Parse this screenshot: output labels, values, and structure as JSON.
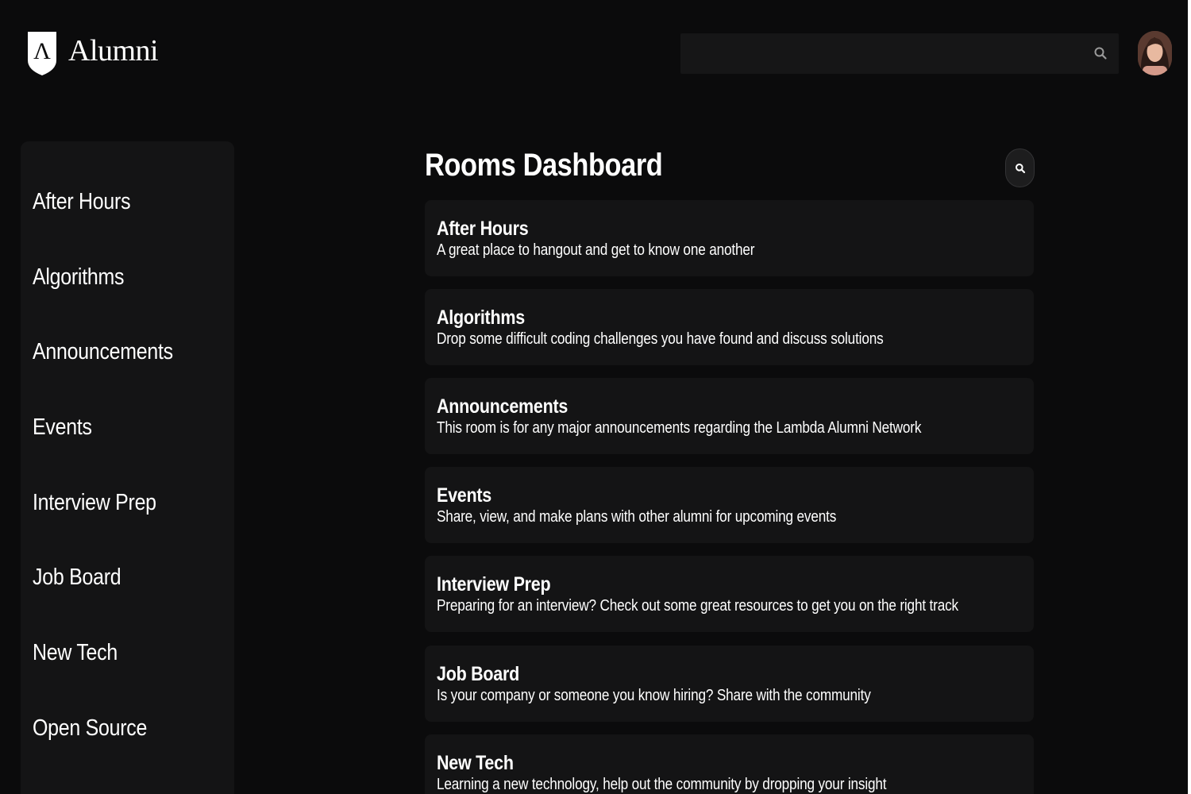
{
  "header": {
    "logo_text": "Alumni",
    "logo_letter": "Λ",
    "search": {
      "value": "",
      "placeholder": ""
    }
  },
  "sidebar": {
    "items": [
      {
        "label": "After Hours"
      },
      {
        "label": "Algorithms"
      },
      {
        "label": "Announcements"
      },
      {
        "label": "Events"
      },
      {
        "label": "Interview Prep"
      },
      {
        "label": "Job Board"
      },
      {
        "label": "New Tech"
      },
      {
        "label": "Open Source"
      }
    ]
  },
  "main": {
    "title": "Rooms Dashboard",
    "rooms": [
      {
        "name": "After Hours",
        "description": "A great place to hangout and get to know one another"
      },
      {
        "name": "Algorithms",
        "description": "Drop some difficult coding challenges you have found and discuss solutions"
      },
      {
        "name": "Announcements",
        "description": "This room is for any major announcements regarding the Lambda Alumni Network"
      },
      {
        "name": "Events",
        "description": "Share, view, and make plans with other alumni for upcoming events"
      },
      {
        "name": "Interview Prep",
        "description": "Preparing for an interview? Check out some great resources to get you on the right track"
      },
      {
        "name": "Job Board",
        "description": "Is your company or someone you know hiring? Share with the community"
      },
      {
        "name": "New Tech",
        "description": "Learning a new technology, help out the community by dropping your insight"
      }
    ]
  },
  "icons": {
    "logo": "shield-lambda-icon",
    "header_search": "search-icon",
    "rooms_search": "search-icon",
    "avatar": "user-avatar"
  },
  "colors": {
    "background": "#0b0b0c",
    "card": "#141415",
    "search_bar": "#161617",
    "text": "#ffffff"
  }
}
